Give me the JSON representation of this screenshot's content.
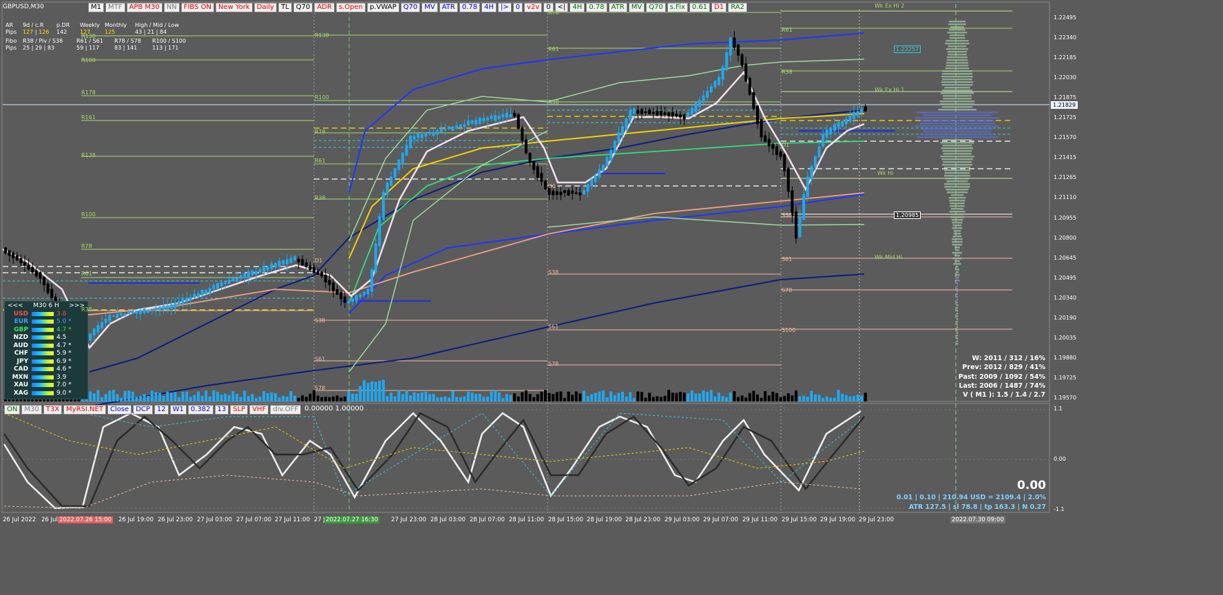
{
  "symbol": "GBPUSD,M30",
  "toolbar": [
    "M1",
    "MTF",
    "APB M30",
    "NN",
    "FIBS ON",
    "New York",
    "Daily",
    "TL",
    "Q70",
    "ADR",
    "s.Open",
    "p.VWAP",
    "Q70",
    "MV",
    "ATR",
    "0.78",
    "4H",
    "|>",
    "0",
    "v2v",
    "0",
    "<|",
    "4H",
    "0.78",
    "ATR",
    "MV",
    "Q70",
    "s.Fix",
    "0.61",
    "D1",
    "RA2"
  ],
  "toolbar_colors": [
    "black",
    "gray",
    "red",
    "gray",
    "red",
    "red",
    "red",
    "black",
    "black",
    "red",
    "red",
    "black",
    "blue",
    "blue",
    "blue",
    "blue",
    "blue",
    "blue",
    "blue",
    "red",
    "black",
    "black",
    "green",
    "green",
    "green",
    "green",
    "green",
    "green",
    "green",
    "red",
    "green"
  ],
  "toolbar2": [
    "ON",
    "M30",
    "T3X",
    "MyRSI.NET",
    "Close",
    "DCP",
    "12",
    "W1",
    "0.382",
    "13",
    "SLP",
    "VHF",
    "div.OFF"
  ],
  "toolbar2_colors": [
    "green",
    "gray",
    "red",
    "red",
    "blue",
    "blue",
    "blue",
    "blue",
    "blue",
    "blue",
    "red",
    "red",
    "gray"
  ],
  "toolbar2_extra": "0.00000 1.00000",
  "info": {
    "ar_label": "AR",
    "pips_label": "Pips",
    "d_head": "9d / c.R",
    "d_val1": "127",
    "d_val2": "126",
    "pdr_head": "p.DR",
    "pdr_val": "142",
    "weekly_head": "Weekly",
    "weekly_val": "127",
    "monthly_head": "Monthly",
    "monthly_val": "125",
    "hml_head": "High / Mid / Low",
    "hml_val": "43  |  21  |  84",
    "fibo_label": "Fibo",
    "fibo_pips": "Pips",
    "fibo1_head": "R38 / Piv / S38",
    "fibo1_val": "25  |  29  |  83",
    "fibo2_head": "R61 / S61",
    "fibo2_val": "59  |  117",
    "fibo3_head": "R78 / S78",
    "fibo3_val": "83  |  141",
    "fibo4_head": "R100 / S100",
    "fibo4_val": "113  |  171"
  },
  "currency_panel": {
    "prev": "<<<",
    "tf": "M30  6  H",
    "next": ">>>",
    "rows": [
      {
        "name": "USD",
        "value": "3.8",
        "color": "#ff5050",
        "vcolor": "#ff5050"
      },
      {
        "name": "EUR",
        "value": "5.0 *",
        "color": "#3fa0ff",
        "vcolor": "#3fa0ff"
      },
      {
        "name": "GBP",
        "value": "4.7 *",
        "color": "#40e060",
        "vcolor": "#40e060"
      },
      {
        "name": "NZD",
        "value": "4.5",
        "color": "#ffffff",
        "vcolor": "#ffffff"
      },
      {
        "name": "AUD",
        "value": "4.7 *",
        "color": "#ffffff",
        "vcolor": "#ffffff"
      },
      {
        "name": "CHF",
        "value": "5.9 *",
        "color": "#ffffff",
        "vcolor": "#ffffff"
      },
      {
        "name": "JPY",
        "value": "6.9 *",
        "color": "#ffffff",
        "vcolor": "#ffffff"
      },
      {
        "name": "CAD",
        "value": "4.6 *",
        "color": "#ffffff",
        "vcolor": "#ffffff"
      },
      {
        "name": "MXN",
        "value": "3.9",
        "color": "#ffffff",
        "vcolor": "#ffffff"
      },
      {
        "name": "XAU",
        "value": "7.0 *",
        "color": "#ffffff",
        "vcolor": "#ffffff"
      },
      {
        "name": "XAG",
        "value": "9.0 *",
        "color": "#ffffff",
        "vcolor": "#ffffff"
      }
    ]
  },
  "stats": [
    "W: 2011 / 312 / 16%",
    "Prev: 2012 / 829 / 41%",
    "Past: 2009 / 1092 / 54%",
    "Last: 2006 / 1487 / 74%",
    "V ( M1 ): 1.5 / 1.4 / 2.7"
  ],
  "osc_value": "0.00",
  "osc_line1": "0.01  |  0.10  |  210.94 USD = 2109.4  |  2.0%",
  "osc_line2": "ATR 127.5  |  sl 78.8  |  tp 163.3  |  N 0.27",
  "price_axis": [
    "1.22495",
    "1.22340",
    "1.22185",
    "1.22030",
    "1.21875",
    "1.21725",
    "1.21570",
    "1.21415",
    "1.21265",
    "1.21110",
    "1.20955",
    "1.20800",
    "1.20645",
    "1.20495",
    "1.20340",
    "1.20190",
    "1.20035",
    "1.19880",
    "1.19725",
    "1.19570"
  ],
  "current_price": "1.21829",
  "tag_price1": "1.22257",
  "tag_price2": "1.20985",
  "osc_axis": [
    "1.1",
    "0.00",
    "-1.1"
  ],
  "time_axis": [
    "26 Jul 2022",
    "26 Jul 1",
    "2022.07.26 15:00",
    "26 Jul 19:00",
    "26 Jul 23:00",
    "27 Jul 03:00",
    "27 Jul 07:00",
    "27 Jul 11:00",
    "27 J",
    "2022.07.27 16:30",
    "27 Jul 23:00",
    "28 Jul 03:00",
    "28 Jul 07:00",
    "28 Jul 11:00",
    "28 Jul 15:00",
    "28 Jul 19:00",
    "28 Jul 23:00",
    "29 Jul 03:00",
    "29 Jul 07:00",
    "29 Jul 11:00",
    "29 Jul 15:00",
    "29 Jul 19:00",
    "29 Jul 23:00",
    "2022.07.30 09:00"
  ],
  "levels_left": [
    "R138",
    "R100",
    "R178",
    "R161",
    "R138",
    "R100",
    "R78",
    "R61",
    "R38"
  ],
  "levels_mid1": [
    "R138",
    "R100",
    "R78",
    "R61",
    "R38",
    "D1",
    "S38",
    "S61",
    "S78"
  ],
  "levels_mid2": [
    "R78",
    "R61",
    "R38",
    "D1",
    "S38",
    "S61",
    "S78"
  ],
  "levels_right": [
    "R61",
    "R38",
    "D1",
    "S38",
    "S61",
    "S78",
    "S100"
  ],
  "weekly_labels": [
    "Wk Ex Hi 2",
    "Wk Ex Hi 1",
    "Wk Hi",
    "Wk Mid Hi"
  ],
  "colors": {
    "bg": "#5b5b5b",
    "bull": "#21a7ef",
    "bear": "#000000",
    "fib": "#f3b9a2",
    "accent_yellow": "#f5d000",
    "grid": "#8a8a8a"
  }
}
